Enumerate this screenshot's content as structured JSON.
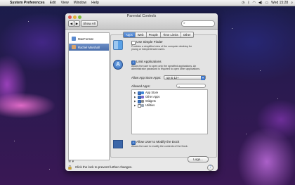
{
  "menubar": {
    "apple": "",
    "app_name": "System Preferences",
    "items": [
      "Edit",
      "View",
      "Window",
      "Help"
    ],
    "clock": "Wed 15:28"
  },
  "window": {
    "title": "Parental Controls",
    "show_all": "Show All",
    "back": "◀",
    "forward": "▶",
    "search_placeholder": ""
  },
  "sidebar": {
    "users": [
      {
        "name": "MacFormat",
        "selected": false
      },
      {
        "name": "Rachel Marshall",
        "selected": true
      }
    ],
    "settings_label": "✲ ▾"
  },
  "tabs": [
    "Apps",
    "Web",
    "People",
    "Time Limits",
    "Other"
  ],
  "apps": {
    "simple_finder": {
      "label": "Use Simple Finder",
      "checked": false,
      "desc1": "Provides a simplified view of the computer desktop for",
      "desc2": "young or inexperienced users."
    },
    "limit_apps": {
      "label": "Limit Applications",
      "checked": true,
      "desc1": "Allows the user to open only the specified applications. An",
      "desc2": "administrator password is required to open other applications."
    },
    "app_store_label": "Allow App Store Apps:",
    "app_store_value": "up to 12+",
    "allowed_label": "Allowed Apps:",
    "allowed_list": [
      {
        "name": "App Store",
        "checked": true,
        "color": "#3f86d6"
      },
      {
        "name": "Other Apps",
        "checked": true,
        "color": "#7a6acc"
      },
      {
        "name": "Widgets",
        "checked": true,
        "color": "#8a8a8a"
      },
      {
        "name": "Utilities",
        "checked": false,
        "color": "#9aa6b4"
      }
    ],
    "dock": {
      "label": "Allow User to Modify the Dock",
      "checked": true,
      "desc": "Allows the user to modify the contents of the Dock."
    },
    "logs_button": "Logs..."
  },
  "footer": {
    "lock_text": "Click the lock to prevent further changes.",
    "help": "?"
  }
}
